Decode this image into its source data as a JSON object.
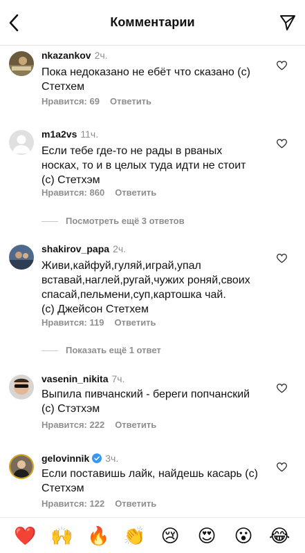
{
  "header": {
    "title": "Комментарии",
    "back_icon": "chevron-left-icon",
    "share_icon": "paper-plane-icon"
  },
  "comments": [
    {
      "username": "nkazankov",
      "time": "2ч.",
      "text": "Пока недоказано не ебёт что сказано (с)\nСтетхем",
      "likes": "Нравится: 69",
      "reply": "Ответить"
    },
    {
      "username": "m1a2vs",
      "time": "11ч.",
      "text": "Если тебе где-то не рады в рваных\nноскаx, то и в целых туда идти не стоит\n(с) Стетхэм",
      "likes": "Нравится: 860",
      "reply": "Ответить"
    },
    {
      "username": "shakirov_papa",
      "time": "2ч.",
      "text": "Живи,кайфуй,гуляй,играй,упал\nвставай,наглей,ругай,чужих роняй,своих\nспасай,пельмени,суп,картошка чай.\n(с) Джейсон Стетхем",
      "likes": "Нравится: 119",
      "reply": "Ответить"
    },
    {
      "username": "vasenin_nikita",
      "time": "7ч.",
      "text": "Выпила пивчанский - береги попчанский\n(с) Стэтхэм",
      "likes": "Нравится: 222",
      "reply": "Ответить"
    },
    {
      "username": "gelovinnik",
      "time": "3ч.",
      "text": "Если поставишь лайк, найдешь касарь (с)\nСтетхэм",
      "likes": "Нравится: 122",
      "reply": "Ответить"
    }
  ],
  "view_more_1": "Посмотреть ещё 3 ответов",
  "view_more_2": "Показать ещё 1 ответ",
  "emoji_bar": [
    "❤️",
    "🙌",
    "🔥",
    "👏",
    "😢",
    "😍",
    "😮",
    "😂"
  ]
}
